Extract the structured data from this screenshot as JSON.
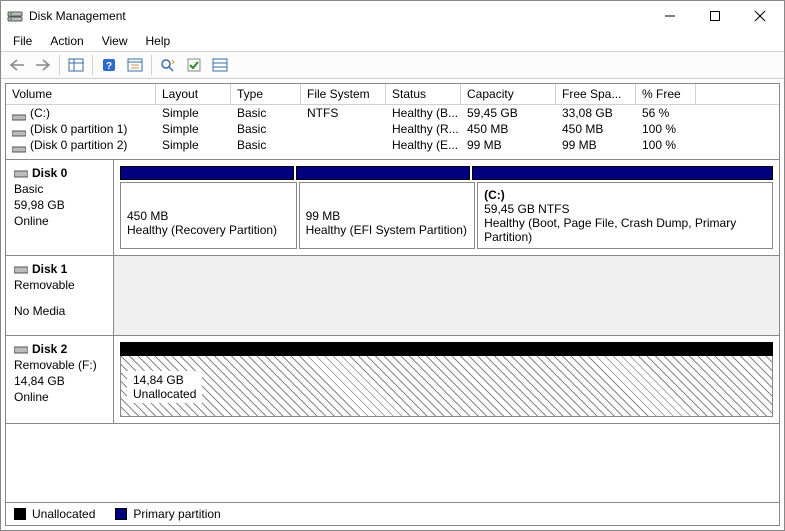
{
  "window": {
    "title": "Disk Management"
  },
  "menu": {
    "file": "File",
    "action": "Action",
    "view": "View",
    "help": "Help"
  },
  "columns": {
    "volume": "Volume",
    "layout": "Layout",
    "type": "Type",
    "fs": "File System",
    "status": "Status",
    "capacity": "Capacity",
    "free": "Free Spa...",
    "pfree": "% Free"
  },
  "volumes": [
    {
      "name": "(C:)",
      "layout": "Simple",
      "type": "Basic",
      "fs": "NTFS",
      "status": "Healthy (B...",
      "capacity": "59,45 GB",
      "free": "33,08 GB",
      "pfree": "56 %"
    },
    {
      "name": "(Disk 0 partition 1)",
      "layout": "Simple",
      "type": "Basic",
      "fs": "",
      "status": "Healthy (R...",
      "capacity": "450 MB",
      "free": "450 MB",
      "pfree": "100 %"
    },
    {
      "name": "(Disk 0 partition 2)",
      "layout": "Simple",
      "type": "Basic",
      "fs": "",
      "status": "Healthy (E...",
      "capacity": "99 MB",
      "free": "99 MB",
      "pfree": "100 %"
    }
  ],
  "disks": {
    "d0": {
      "name": "Disk 0",
      "type": "Basic",
      "size": "59,98 GB",
      "status": "Online",
      "parts": [
        {
          "title": "",
          "size": "450 MB",
          "status": "Healthy (Recovery Partition)"
        },
        {
          "title": "",
          "size": "99 MB",
          "status": "Healthy (EFI System Partition)"
        },
        {
          "title": "(C:)",
          "size": "59,45 GB NTFS",
          "status": "Healthy (Boot, Page File, Crash Dump, Primary Partition)"
        }
      ]
    },
    "d1": {
      "name": "Disk 1",
      "type": "Removable",
      "status": "No Media"
    },
    "d2": {
      "name": "Disk 2",
      "type": "Removable (F:)",
      "size": "14,84 GB",
      "status": "Online",
      "unalloc": {
        "size": "14,84 GB",
        "label": "Unallocated"
      }
    }
  },
  "legend": {
    "unallocated": "Unallocated",
    "primary": "Primary partition"
  },
  "colors": {
    "primary": "#00007f",
    "unallocated": "#000000"
  }
}
